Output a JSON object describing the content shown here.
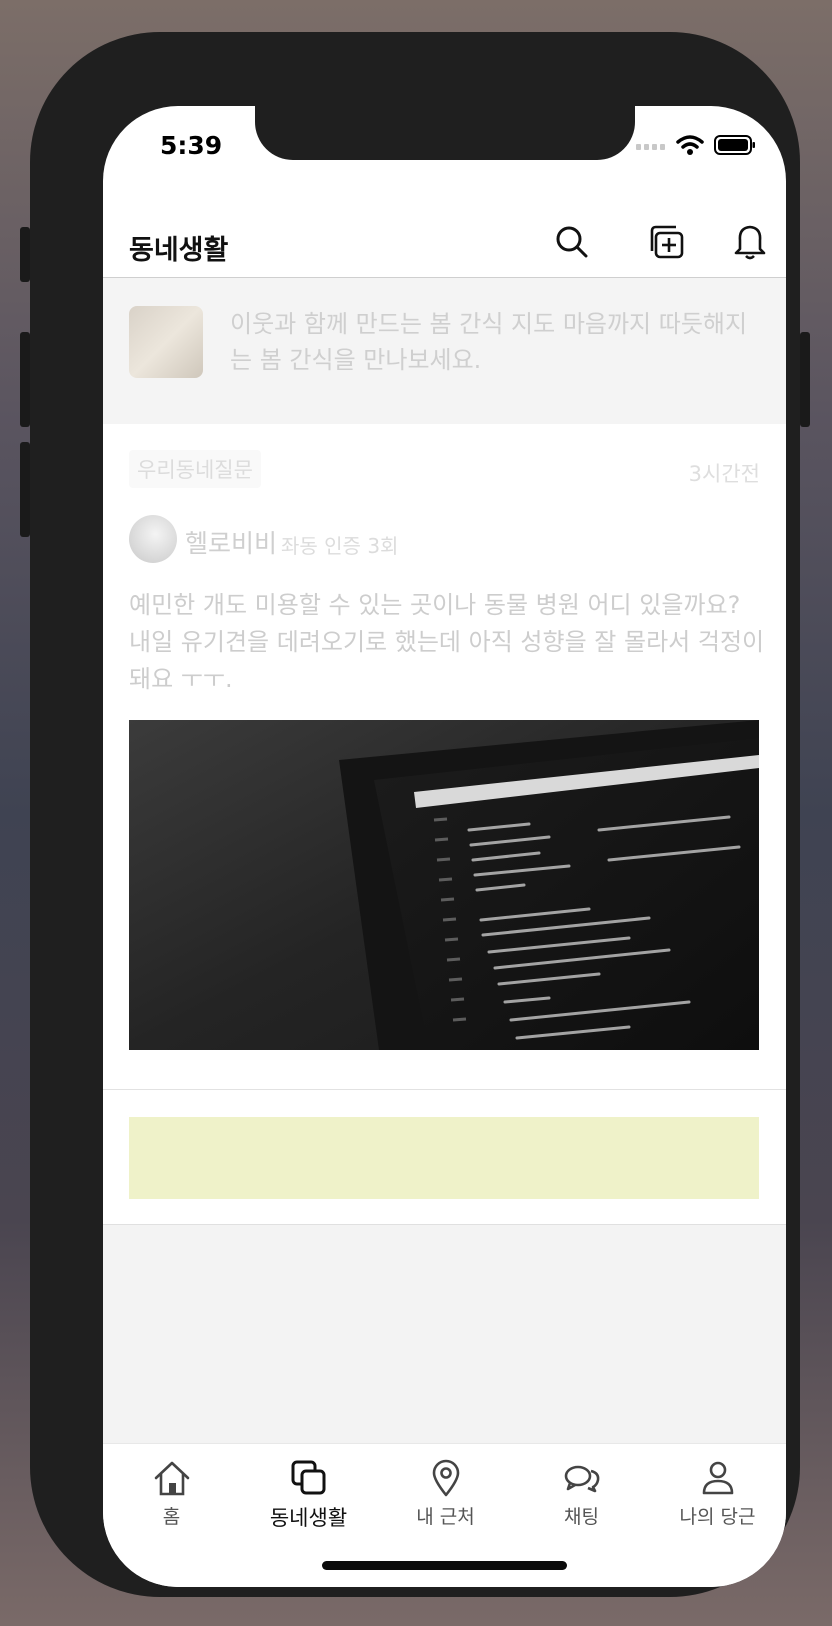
{
  "status_bar": {
    "time": "5:39"
  },
  "header": {
    "title": "동네생활"
  },
  "banner": {
    "text": "이웃과 함께 만드는 봄 간식 지도 마음까지 따듯해지는 봄 간식을 만나보세요."
  },
  "post": {
    "category": "우리동네질문",
    "time": "3시간전",
    "author": "헬로비비",
    "author_meta": "좌동 인증 3회",
    "body": "예민한 개도 미용할 수 있는 곳이나 동물 병원 어디 있을까요? 내일 유기견을 데려오기로 했는데 아직 성향을 잘 몰라서 걱정이 돼요 ㅜㅜ."
  },
  "tabs": [
    {
      "label": "홈",
      "icon": "home-icon",
      "active": false
    },
    {
      "label": "동네생활",
      "icon": "community-icon",
      "active": true
    },
    {
      "label": "내 근처",
      "icon": "location-pin-icon",
      "active": false
    },
    {
      "label": "채팅",
      "icon": "chat-bubbles-icon",
      "active": false
    },
    {
      "label": "나의 당근",
      "icon": "person-icon",
      "active": false
    }
  ],
  "colors": {
    "ad_banner": "#eff2c9",
    "phone_frame": "#1f1f1f"
  }
}
